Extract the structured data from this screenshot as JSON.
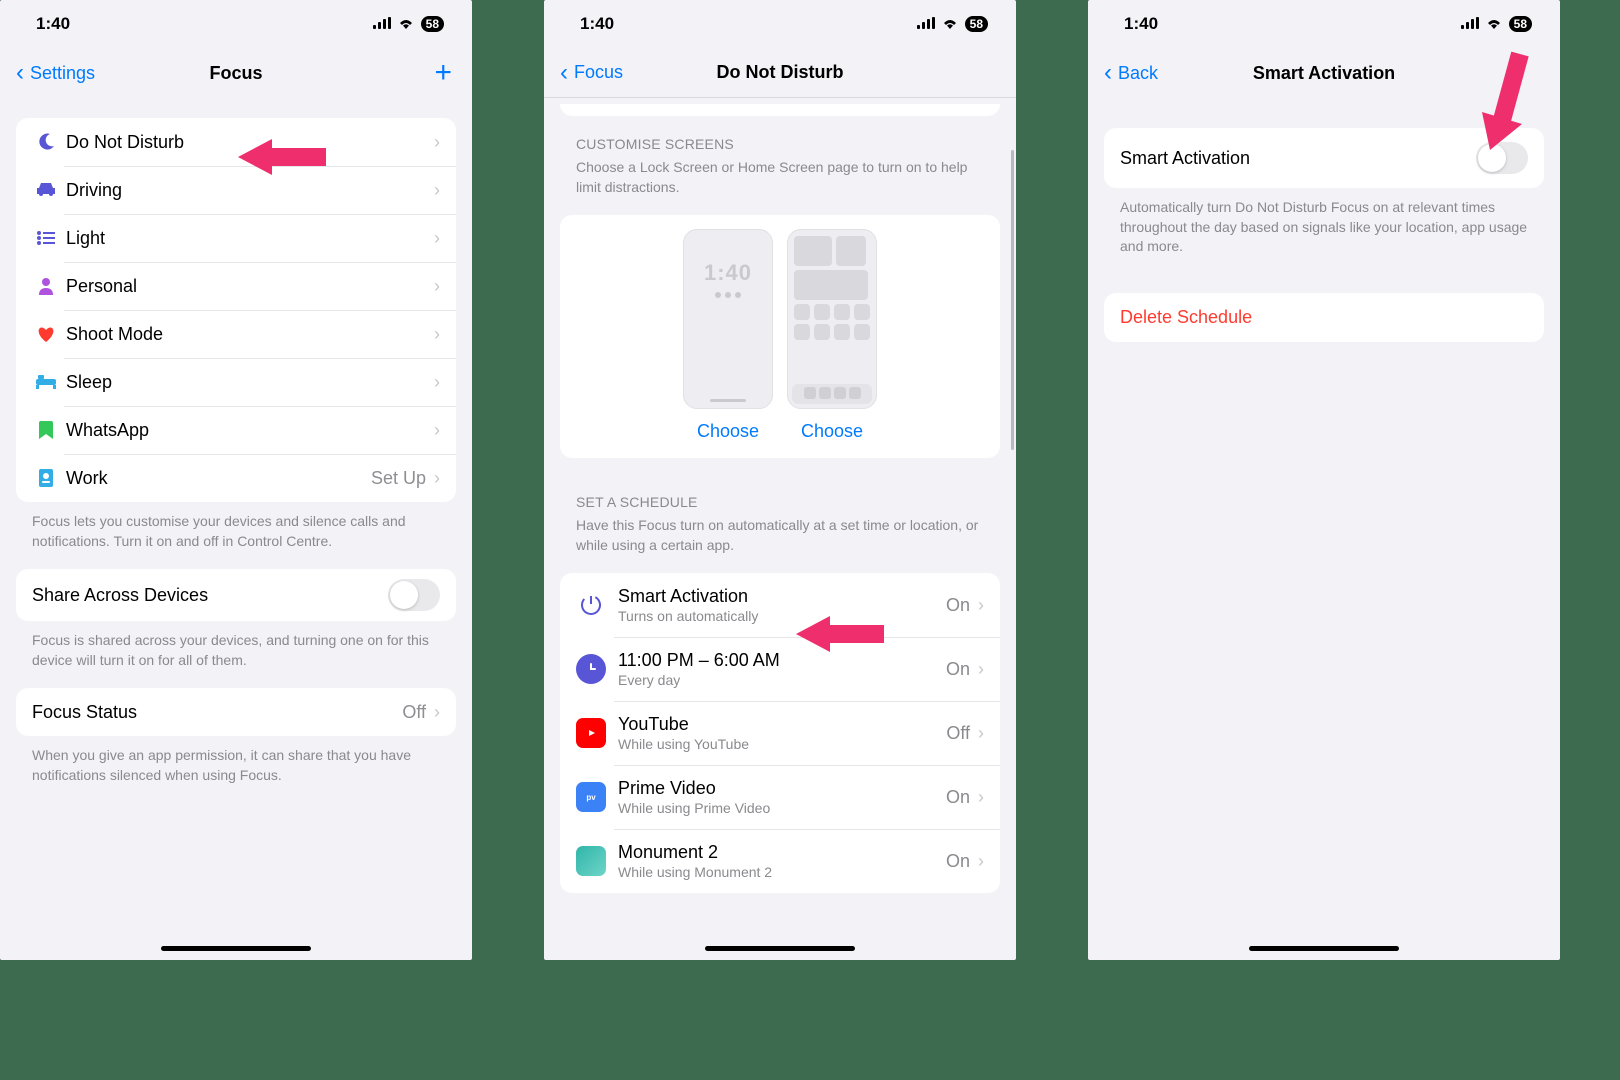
{
  "status": {
    "time": "1:40",
    "battery": "58"
  },
  "colors": {
    "accent": "#007aff",
    "purple": "#af52de",
    "indigo": "#5856d6",
    "red": "#ff3b30",
    "teal": "#32ade6",
    "green": "#34c759",
    "yellow": "#ffcc00",
    "pink_arrow": "#ef2e6d"
  },
  "screen1": {
    "back_label": "Settings",
    "title": "Focus",
    "items": [
      {
        "icon": "moon-icon",
        "color": "#5856d6",
        "label": "Do Not Disturb",
        "value": "",
        "glyph": "☾"
      },
      {
        "icon": "car-icon",
        "color": "#5856d6",
        "label": "Driving",
        "value": "",
        "glyph": "🚗"
      },
      {
        "icon": "list-icon",
        "color": "#5856d6",
        "label": "Light",
        "value": "",
        "glyph": "≣"
      },
      {
        "icon": "person-icon",
        "color": "#af52de",
        "label": "Personal",
        "value": "",
        "glyph": "●"
      },
      {
        "icon": "heart-icon",
        "color": "#ff3b30",
        "label": "Shoot Mode",
        "value": "",
        "glyph": "♥"
      },
      {
        "icon": "bed-icon",
        "color": "#32ade6",
        "label": "Sleep",
        "value": "",
        "glyph": "🛏"
      },
      {
        "icon": "tag-icon",
        "color": "#34c759",
        "label": "WhatsApp",
        "value": "",
        "glyph": "▮"
      },
      {
        "icon": "badge-icon",
        "color": "#32ade6",
        "label": "Work",
        "value": "Set Up",
        "glyph": "▢"
      }
    ],
    "footer1": "Focus lets you customise your devices and silence calls and notifications. Turn it on and off in Control Centre.",
    "share_label": "Share Across Devices",
    "footer2": "Focus is shared across your devices, and turning one on for this device will turn it on for all of them.",
    "status_label": "Focus Status",
    "status_value": "Off",
    "footer3": "When you give an app permission, it can share that you have notifications silenced when using Focus."
  },
  "screen2": {
    "back_label": "Focus",
    "title": "Do Not Disturb",
    "customise_header": "CUSTOMISE SCREENS",
    "customise_sub": "Choose a Lock Screen or Home Screen page to turn on to help limit distractions.",
    "lock_time": "1:40",
    "choose_label": "Choose",
    "schedule_header": "SET A SCHEDULE",
    "schedule_sub": "Have this Focus turn on automatically at a set time or location, or while using a certain app.",
    "schedules": [
      {
        "icon": "power-icon",
        "bg": "",
        "fg": "#5856d6",
        "title": "Smart Activation",
        "sub": "Turns on automatically",
        "value": "On"
      },
      {
        "icon": "clock-icon",
        "bg": "#5856d6",
        "fg": "#fff",
        "title": "11:00 PM – 6:00 AM",
        "sub": "Every day",
        "value": "On"
      },
      {
        "icon": "youtube-icon",
        "bg": "#ff0000",
        "fg": "#fff",
        "title": "YouTube",
        "sub": "While using YouTube",
        "value": "Off"
      },
      {
        "icon": "prime-icon",
        "bg": "#3b82f6",
        "fg": "#fff",
        "title": "Prime Video",
        "sub": "While using Prime Video",
        "value": "On"
      },
      {
        "icon": "monument-icon",
        "bg": "#2fb5a8",
        "fg": "#fff",
        "title": "Monument 2",
        "sub": "While using Monument 2",
        "value": "On"
      }
    ]
  },
  "screen3": {
    "back_label": "Back",
    "title": "Smart Activation",
    "toggle_label": "Smart Activation",
    "footer": "Automatically turn Do Not Disturb Focus on at relevant times throughout the day based on signals like your location, app usage and more.",
    "delete_label": "Delete Schedule"
  }
}
